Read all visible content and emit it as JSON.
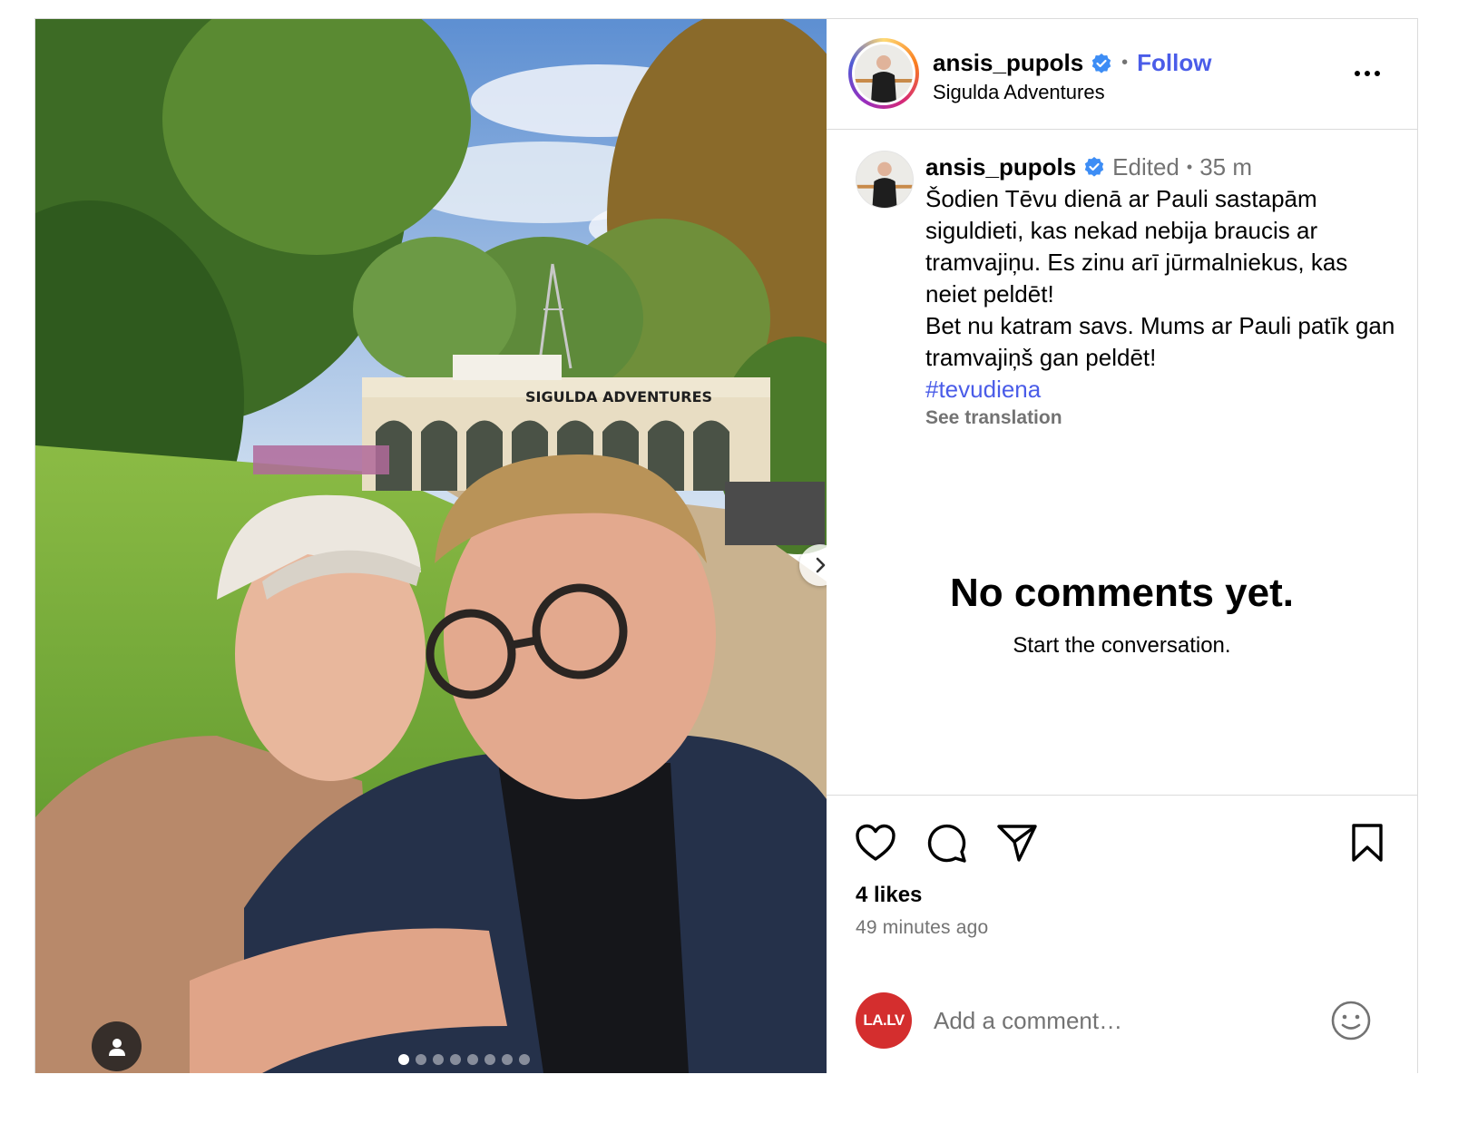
{
  "post": {
    "username": "ansis_pupols",
    "follow_label": "Follow",
    "location": "Sigulda Adventures",
    "edited_label": "Edited",
    "age": "35 m",
    "caption_lines": [
      "Šodien Tēvu dienā ar Pauli sastapām siguldieti, kas nekad nebija braucis ar tramvajiņu. Es zinu arī jūrmalniekus, kas neiet peldēt!",
      "Bet nu katram savs. Mums ar Pauli patīk gan tramvajiņš gan peldēt!"
    ],
    "hashtag": "#tevudiena",
    "see_translation": "See translation",
    "photo_sign": "SIGULDA   ADVENTURES",
    "carousel": {
      "count": 8,
      "active_index": 0
    }
  },
  "comments": {
    "empty_title": "No comments yet.",
    "empty_subtitle": "Start the conversation."
  },
  "footer": {
    "likes": "4 likes",
    "posted_ago": "49 minutes ago",
    "commenter_avatar_text": "LA.LV",
    "comment_placeholder": "Add a comment…"
  },
  "icons": {
    "verified": "verified-badge-icon",
    "more": "more-options-icon",
    "like": "heart-icon",
    "comment": "comment-bubble-icon",
    "share": "paper-plane-icon",
    "save": "bookmark-icon",
    "emoji": "emoji-smiley-icon",
    "next": "chevron-right-icon",
    "tagged_people": "person-icon"
  },
  "colors": {
    "link_blue": "#4a5ce8",
    "verified_blue": "#3d8df5",
    "muted": "#737373",
    "border": "#dbdbdb",
    "commenter_avatar_bg": "#d42e2e"
  }
}
